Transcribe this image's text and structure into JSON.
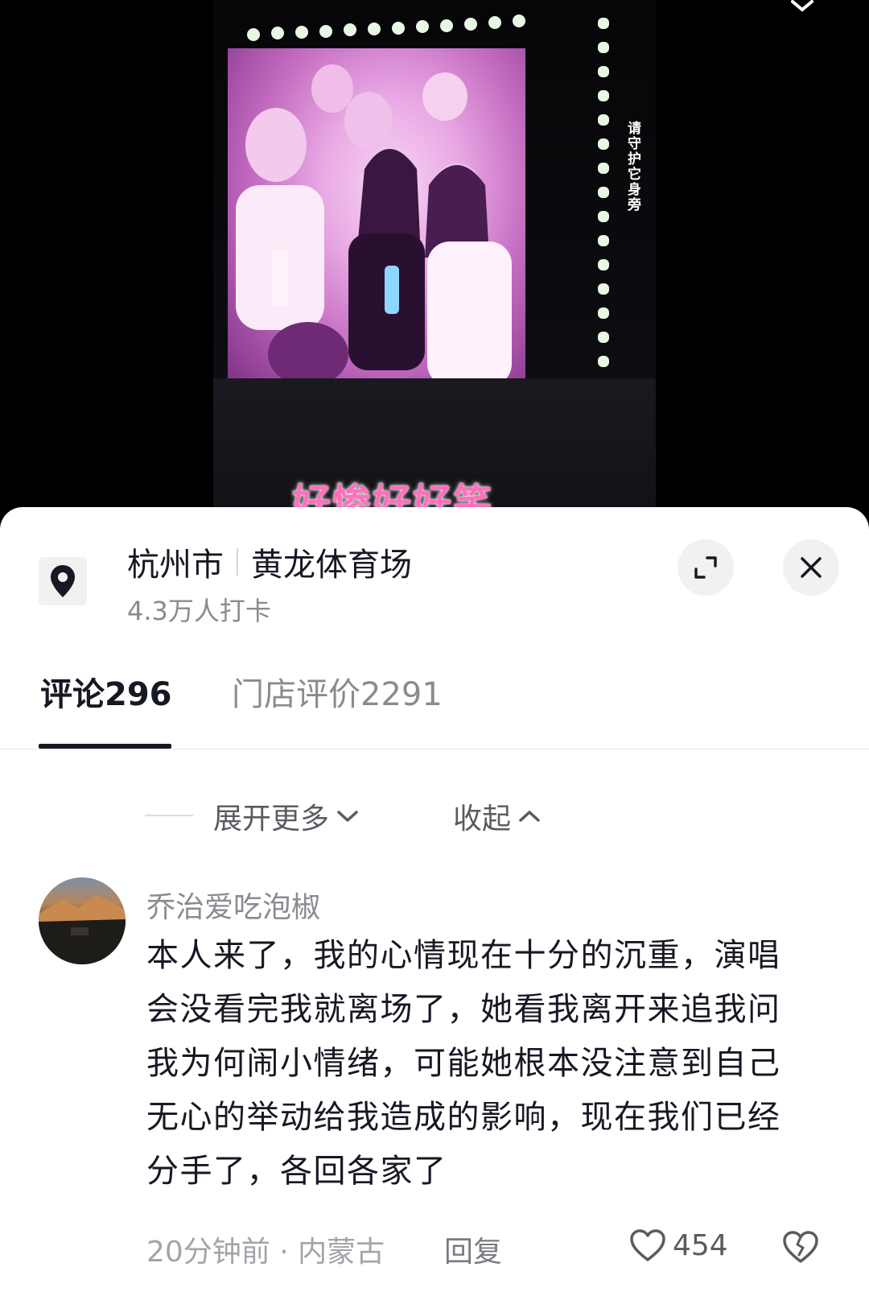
{
  "video": {
    "vertical_caption": "请守护它身旁",
    "subtitle": "好惨好好笑"
  },
  "location": {
    "city": "杭州市",
    "venue": "黄龙体育场",
    "checkins": "4.3万人打卡",
    "pin_icon": "location-pin-icon"
  },
  "actions": {
    "expand_icon": "expand-icon",
    "close_icon": "close-icon"
  },
  "tabs": [
    {
      "label": "评论296",
      "active": true
    },
    {
      "label": "门店评价2291",
      "active": false
    }
  ],
  "thread_controls": {
    "expand_more": "展开更多",
    "collapse": "收起"
  },
  "comment": {
    "username": "乔治爱吃泡椒",
    "text": "本人来了，我的心情现在十分的沉重，演唱会没看完我就离场了，她看我离开来追我问我为何闹小情绪，可能她根本没注意到自己无心的举动给我造成的影响，现在我们已经分手了，各回各家了",
    "time_location": "20分钟前 · 内蒙古",
    "reply_label": "回复",
    "likes": "454"
  },
  "colors": {
    "text_primary": "#161823",
    "text_secondary": "#8a8b91",
    "subtitle_pink": "#ff6fbc",
    "button_bg": "#f1f1f2"
  }
}
